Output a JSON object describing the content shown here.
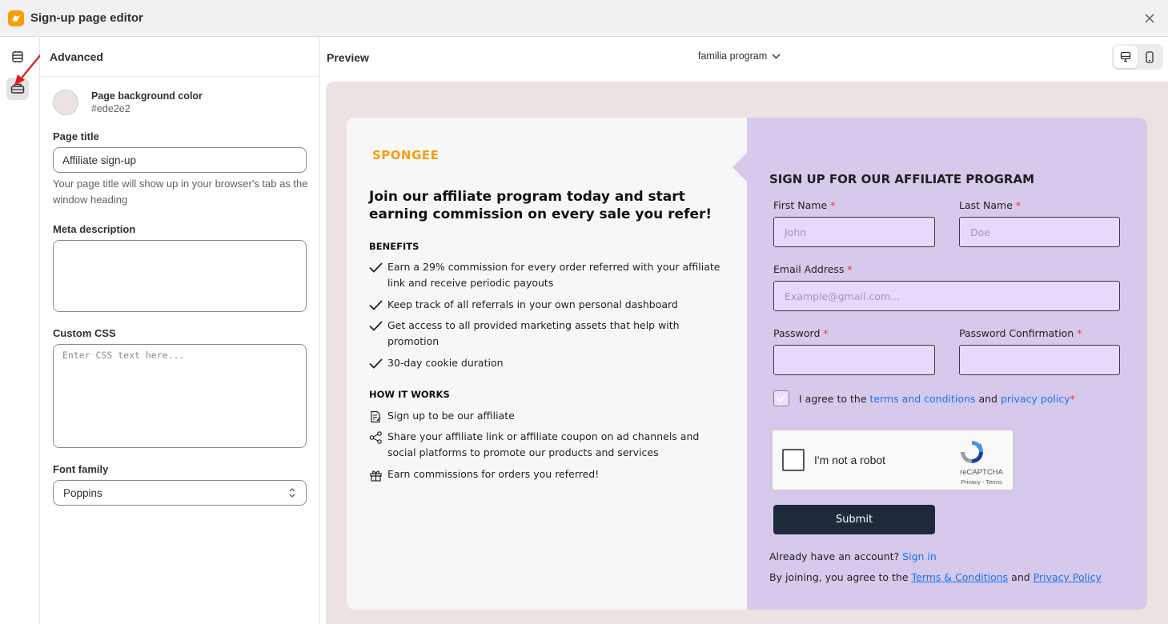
{
  "window": {
    "title": "Sign-up page editor",
    "logo_icon": "app-logo-icon",
    "close_icon": "close-icon"
  },
  "rail": {
    "items": [
      {
        "name": "layout-icon",
        "active": false
      },
      {
        "name": "advanced-settings-icon",
        "active": true
      }
    ],
    "annotation": "red-arrow-pointer"
  },
  "panel": {
    "title": "Advanced",
    "background": {
      "label": "Page background color",
      "value": "#ede2e2"
    },
    "page_title": {
      "label": "Page title",
      "value": "Affiliate sign-up",
      "help": "Your page title will show up in your browser's tab as the window heading"
    },
    "meta_description": {
      "label": "Meta description",
      "value": ""
    },
    "custom_css": {
      "label": "Custom CSS",
      "placeholder": "Enter CSS text here..."
    },
    "font_family": {
      "label": "Font family",
      "value": "Poppins"
    }
  },
  "preview": {
    "label": "Preview",
    "program": "familia program",
    "devices": [
      {
        "name": "desktop-icon",
        "active": true
      },
      {
        "name": "mobile-icon",
        "active": false
      }
    ]
  },
  "signup": {
    "brand": "SPONGEE",
    "headline": "Join our affiliate program today and start earning commission on every sale you refer!",
    "benefits_heading": "BENEFITS",
    "benefits": [
      "Earn a 29% commission for every order referred with your affiliate link and receive periodic payouts",
      "Keep track of all referrals in your own personal dashboard",
      "Get access to all provided marketing assets that help with promotion",
      "30-day cookie duration"
    ],
    "how_heading": "HOW IT WORKS",
    "how_it_works": [
      {
        "icon": "document-edit-icon",
        "text": "Sign up to be our affiliate"
      },
      {
        "icon": "share-icon",
        "text": "Share your affiliate link or affiliate coupon on ad channels and social platforms to promote our products and services"
      },
      {
        "icon": "gift-icon",
        "text": "Earn commissions for orders you referred!"
      }
    ],
    "form": {
      "title": "SIGN UP FOR OUR AFFILIATE PROGRAM",
      "first_name": {
        "label": "First Name",
        "placeholder": "John"
      },
      "last_name": {
        "label": "Last Name",
        "placeholder": "Doe"
      },
      "email": {
        "label": "Email Address",
        "placeholder": "Example@gmail.com..."
      },
      "password": {
        "label": "Password"
      },
      "password_confirm": {
        "label": "Password Confirmation"
      },
      "required_mark": "*",
      "agree": {
        "prefix": "I agree to the",
        "terms": "terms and conditions",
        "and": "and",
        "privacy": "privacy policy",
        "checked": true
      },
      "captcha": {
        "label": "I'm not a robot",
        "brand": "reCAPTCHA",
        "links": "Privacy - Terms"
      },
      "submit": "Submit",
      "account": {
        "text": "Already have an account?",
        "link": "Sign in"
      },
      "joining": {
        "text": "By joining, you agree to the",
        "terms": "Terms & Conditions",
        "and": "and",
        "privacy": "Privacy Policy"
      }
    }
  },
  "colors": {
    "brand": "#f59e0b",
    "canvas_bg": "#ede2e2",
    "form_bg": "#d6c9ec",
    "input_bg": "#e7d9fb",
    "submit_bg": "#1e293b",
    "link": "#1a73e8",
    "required": "#e53935"
  }
}
